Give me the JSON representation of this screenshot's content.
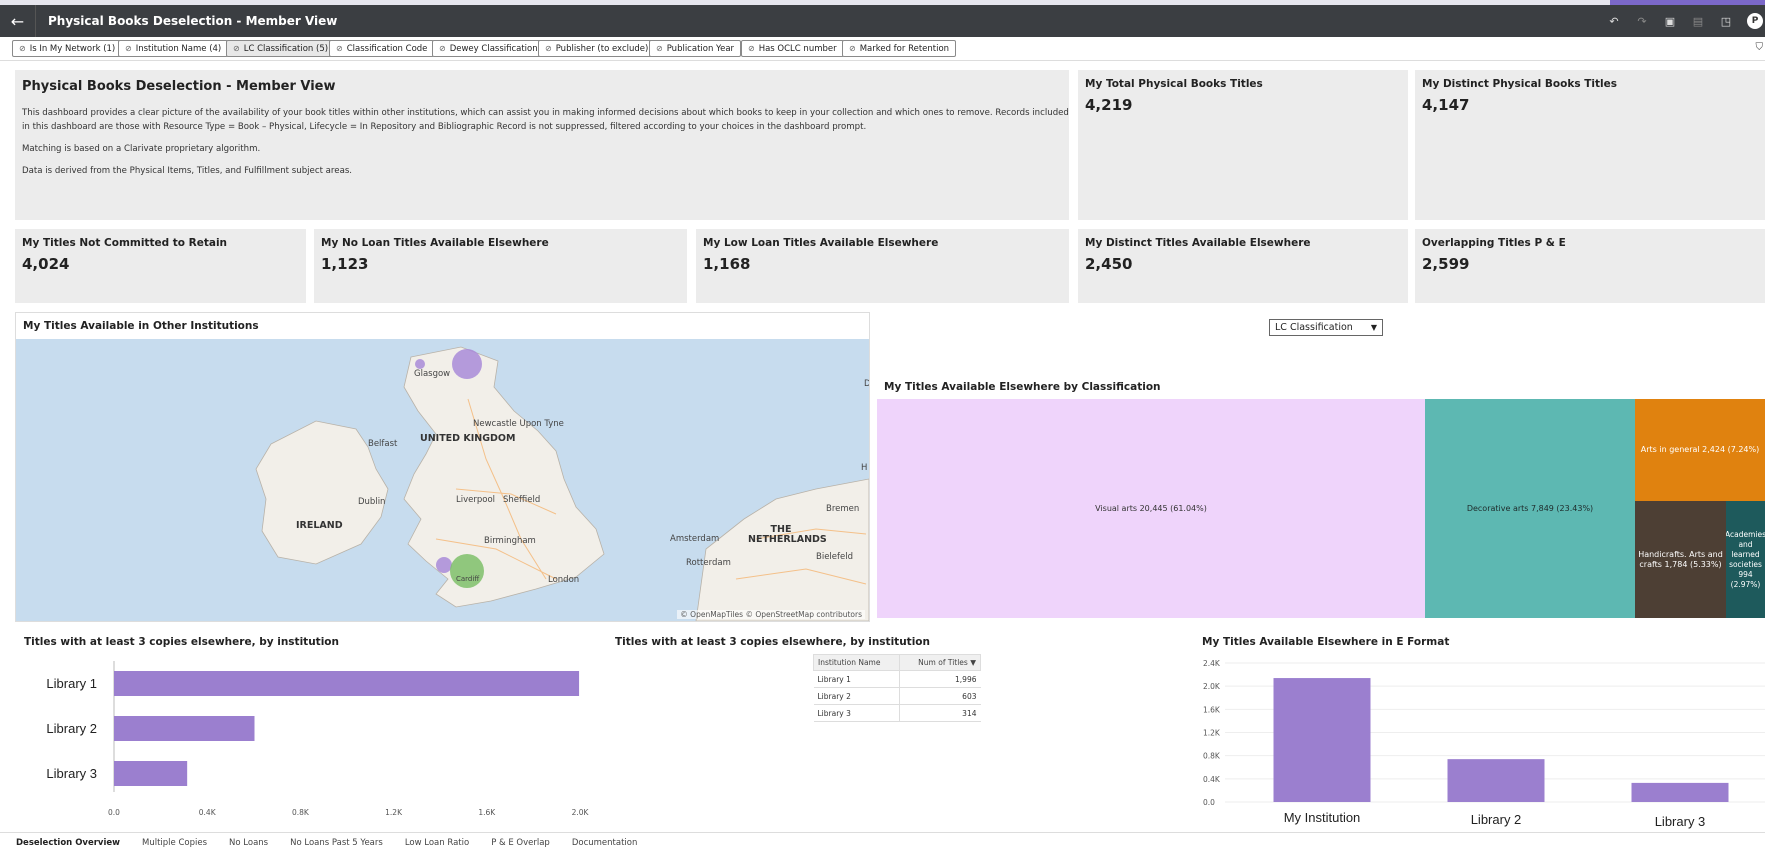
{
  "header": {
    "back_icon": "arrow-left-icon",
    "title": "Physical Books Deselection - Member View",
    "avatar_initial": "P"
  },
  "filters": [
    {
      "label": "Is In My Network (1)"
    },
    {
      "label": "Institution Name (4)"
    },
    {
      "label": "LC Classification (5)",
      "active": true,
      "remove": "✕"
    },
    {
      "label": "Classification Code"
    },
    {
      "label": "Dewey Classification"
    },
    {
      "label": "Publisher (to exclude)"
    },
    {
      "label": "Publication Year"
    },
    {
      "label": "Has OCLC number"
    },
    {
      "label": "Marked for Retention"
    }
  ],
  "intro": {
    "title": "Physical Books Deselection - Member View",
    "p1": "This dashboard provides a clear picture of the availability of your book titles within other institutions, which can assist you in making informed decisions about which books to keep in your collection and which ones to remove. Records included in this dashboard are those with Resource Type = Book – Physical, Lifecycle = In Repository and Bibliographic Record is not suppressed, filtered according to your choices in the dashboard prompt.",
    "p2": "Matching is based on a Clarivate proprietary algorithm.",
    "p3": "Data is derived from the Physical Items, Titles, and Fulfillment subject areas."
  },
  "kpis": {
    "total_titles": {
      "label": "My Total Physical Books Titles",
      "value": "4,219"
    },
    "distinct_titles": {
      "label": "My Distinct Physical Books Titles",
      "value": "4,147"
    },
    "not_committed": {
      "label": "My Titles Not Committed to Retain",
      "value": "4,024"
    },
    "no_loan": {
      "label": "My No Loan Titles Available Elsewhere",
      "value": "1,123"
    },
    "low_loan": {
      "label": "My Low Loan Titles Available Elsewhere",
      "value": "1,168"
    },
    "distinct_elsewhere": {
      "label": "My Distinct Titles Available Elsewhere",
      "value": "2,450"
    },
    "overlapping": {
      "label": "Overlapping Titles P & E",
      "value": "2,599"
    }
  },
  "map": {
    "title": "My Titles Available in Other Institutions",
    "labels": {
      "glasgow": "Glasgow",
      "newcastle": "Newcastle Upon Tyne",
      "belfast": "Belfast",
      "uk": "UNITED KINGDOM",
      "dublin": "Dublin",
      "liverpool": "Liverpool",
      "sheffield": "Sheffield",
      "ireland": "IRELAND",
      "birmingham": "Birmingham",
      "amsterdam": "Amsterdam",
      "netherlands": "THE NETHERLANDS",
      "rotterdam": "Rotterdam",
      "bremen": "Bremen",
      "bielefeld": "Bielefeld",
      "london": "London",
      "cardiff": "Cardiff",
      "h": "H",
      "d": "D"
    },
    "attribution": "© OpenMapTiles  © OpenStreetMap contributors",
    "colors": {
      "bubble_purple": "#a98bd8",
      "bubble_green": "#7fbf6a",
      "water": "#c7dcee",
      "land": "#f2efe9"
    }
  },
  "classification_select": {
    "value": "LC Classification",
    "arrow_icon": "chevron-down-icon"
  },
  "treemap": {
    "title": "My Titles Available Elsewhere by Classification",
    "tiles": [
      {
        "label": "Visual arts 20,445 (61.04%)",
        "color": "#efd4fb"
      },
      {
        "label": "Decorative arts 7,849 (23.43%)",
        "color": "#5db8b2"
      },
      {
        "label": "Arts in general 2,424 (7.24%)",
        "color": "#e0820f"
      },
      {
        "label": "Handicrafts. Arts and crafts 1,784 (5.33%)",
        "color": "#4d3f34"
      },
      {
        "label": "Academies and learned societies 994 (2.97%)",
        "color": "#1e5a5c"
      }
    ]
  },
  "chart_data": [
    {
      "type": "bar",
      "orientation": "horizontal",
      "title": "Titles with at least 3 copies elsewhere, by institution",
      "categories": [
        "Library 1",
        "Library 2",
        "Library 3"
      ],
      "values": [
        1996,
        603,
        314
      ],
      "xticks": [
        "0.0",
        "0.4K",
        "0.8K",
        "1.2K",
        "1.6K",
        "2.0K"
      ],
      "xlim": [
        0,
        2000
      ],
      "color": "#9b7fcf"
    },
    {
      "type": "table",
      "title": "Titles with at least 3 copies elsewhere, by institution",
      "columns": [
        "Institution Name",
        "Num of Titles"
      ],
      "sort_icon": "caret-down-icon",
      "rows": [
        [
          "Library 1",
          "1,996"
        ],
        [
          "Library 2",
          "603"
        ],
        [
          "Library 3",
          "314"
        ]
      ]
    },
    {
      "type": "bar",
      "title": "My Titles Available Elsewhere in E Format",
      "categories": [
        "My Institution",
        "Library 2",
        "Library 3"
      ],
      "values": [
        2140,
        740,
        330
      ],
      "yticks": [
        "2.4K",
        "2.0K",
        "1.6K",
        "1.2K",
        "0.8K",
        "0.4K",
        "0.0"
      ],
      "ylim": [
        0,
        2400
      ],
      "color": "#9b7fcf"
    }
  ],
  "tabs": [
    {
      "label": "Deselection Overview",
      "active": true
    },
    {
      "label": "Multiple Copies"
    },
    {
      "label": "No Loans"
    },
    {
      "label": "No Loans Past 5 Years"
    },
    {
      "label": "Low Loan Ratio"
    },
    {
      "label": "P & E Overlap"
    },
    {
      "label": "Documentation"
    }
  ]
}
